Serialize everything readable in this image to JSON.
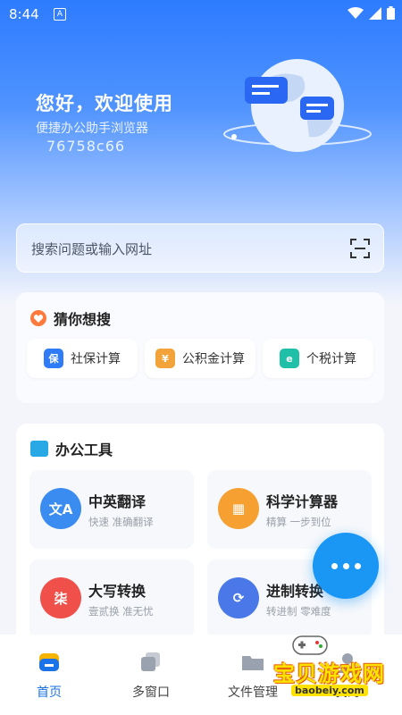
{
  "status": {
    "time": "8:44",
    "notification_icon": "A"
  },
  "hero": {
    "greeting": "您好，欢迎使用",
    "subtitle": "便捷办公助手浏览器",
    "id_code": "76758c66"
  },
  "search": {
    "placeholder": "搜索问题或输入网址"
  },
  "guess": {
    "title": "猜你想搜",
    "chips": [
      {
        "label": "社保计算",
        "icon": "shield-icon",
        "glyph": "保",
        "color": "#2f7cf6"
      },
      {
        "label": "公积金计算",
        "icon": "house-fund-icon",
        "glyph": "¥",
        "color": "#f2a43a"
      },
      {
        "label": "个税计算",
        "icon": "tax-icon",
        "glyph": "e",
        "color": "#20c0a8"
      }
    ]
  },
  "tools": {
    "title": "办公工具",
    "items": [
      {
        "name": "中英翻译",
        "desc": "快速 准确翻译",
        "glyph": "文A",
        "color": "#3b8cf0"
      },
      {
        "name": "科学计算器",
        "desc": "精算 一步到位",
        "glyph": "▦",
        "color": "#f5a030"
      },
      {
        "name": "大写转换",
        "desc": "壹贰换 准无忧",
        "glyph": "柒",
        "color": "#f0504a"
      },
      {
        "name": "进制转换",
        "desc": "转进制 零难度",
        "glyph": "⟳",
        "color": "#4a78e8"
      }
    ]
  },
  "tabbar": {
    "items": [
      {
        "label": "首页",
        "active": true
      },
      {
        "label": "多窗口",
        "active": false
      },
      {
        "label": "文件管理",
        "active": false
      },
      {
        "label": "我的",
        "active": false
      }
    ]
  },
  "watermark": {
    "text": "宝贝游戏网",
    "url": "baobeiy.com"
  },
  "colors": {
    "primary": "#1a73e8",
    "fab": "#1a96f5",
    "hero_top": "#2d7bff"
  }
}
